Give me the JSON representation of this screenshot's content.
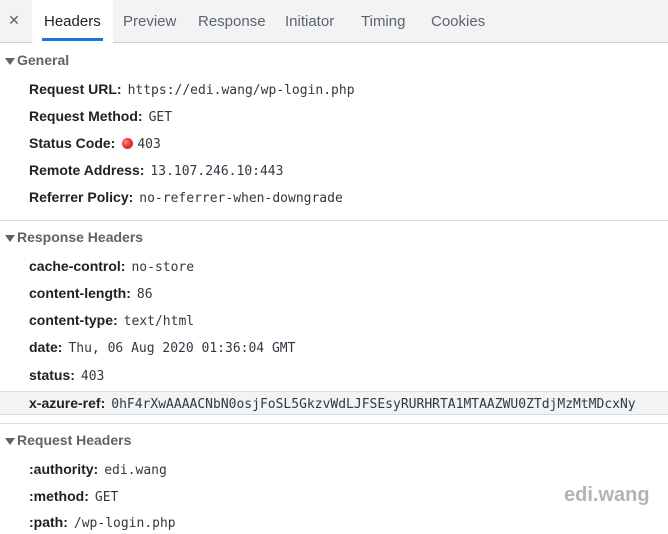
{
  "tabs": [
    "Headers",
    "Preview",
    "Response",
    "Initiator",
    "Timing",
    "Cookies"
  ],
  "close_glyph": "✕",
  "general": {
    "title": "General",
    "rows": [
      {
        "key": "Request URL:",
        "value": "https://edi.wang/wp-login.php"
      },
      {
        "key": "Request Method:",
        "value": "GET"
      },
      {
        "key": "Status Code:",
        "value": "403"
      },
      {
        "key": "Remote Address:",
        "value": "13.107.246.10:443"
      },
      {
        "key": "Referrer Policy:",
        "value": "no-referrer-when-downgrade"
      }
    ]
  },
  "response_headers": {
    "title": "Response Headers",
    "rows": [
      {
        "key": "cache-control:",
        "value": "no-store"
      },
      {
        "key": "content-length:",
        "value": "86"
      },
      {
        "key": "content-type:",
        "value": "text/html"
      },
      {
        "key": "date:",
        "value": "Thu, 06 Aug 2020 01:36:04 GMT"
      },
      {
        "key": "status:",
        "value": "403"
      },
      {
        "key": "x-azure-ref:",
        "value": "0hF4rXwAAAACNbN0osjFoSL5GkzvWdLJFSEsyRURHRTA1MTAAZWU0ZTdjMzMtMDcxNy"
      }
    ]
  },
  "request_headers": {
    "title": "Request Headers",
    "rows": [
      {
        "key": ":authority:",
        "value": "edi.wang"
      },
      {
        "key": ":method:",
        "value": "GET"
      },
      {
        "key": ":path:",
        "value": "/wp-login.php"
      }
    ]
  },
  "watermark": "edi.wang",
  "colors": {
    "accent": "#1a73e8",
    "status_error": "#e53935"
  }
}
